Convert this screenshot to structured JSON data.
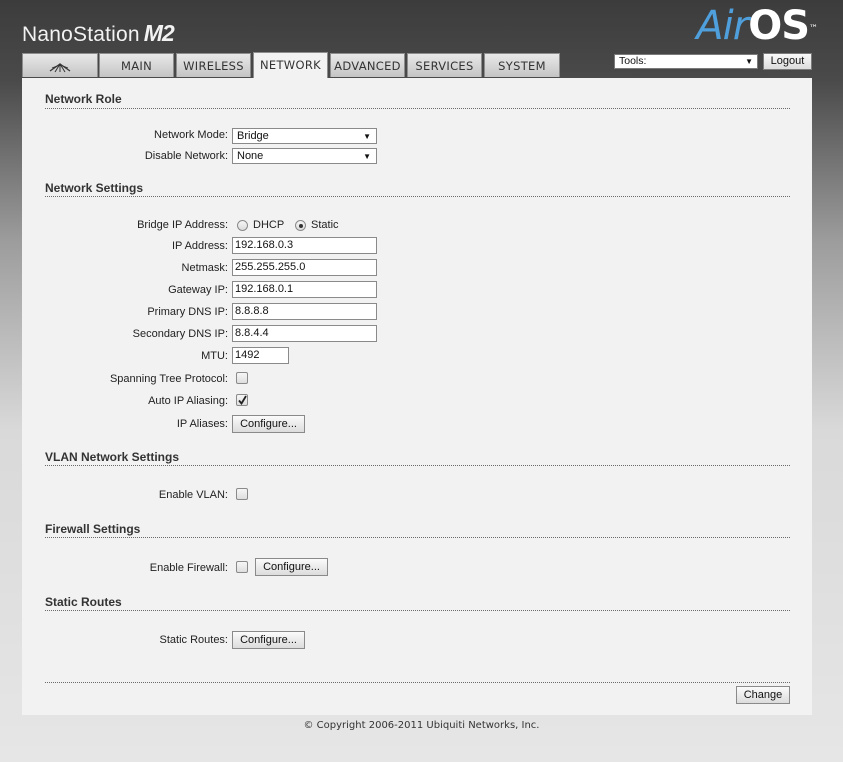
{
  "brand": {
    "name": "NanoStation",
    "model": "M2"
  },
  "logo": {
    "air": "Air",
    "os": "OS",
    "tm": "™"
  },
  "tabs": [
    {
      "icon": "ubiquiti-logo-icon"
    },
    {
      "label": "MAIN"
    },
    {
      "label": "WIRELESS"
    },
    {
      "label": "NETWORK",
      "active": true
    },
    {
      "label": "ADVANCED"
    },
    {
      "label": "SERVICES"
    },
    {
      "label": "SYSTEM"
    }
  ],
  "tools": {
    "value": "Tools:"
  },
  "logout_label": "Logout",
  "network_role": {
    "title": "Network Role",
    "mode_label": "Network Mode:",
    "mode_value": "Bridge",
    "disable_label": "Disable Network:",
    "disable_value": "None"
  },
  "network_settings": {
    "title": "Network Settings",
    "bridge_ip_label": "Bridge IP Address:",
    "dhcp_label": "DHCP",
    "static_label": "Static",
    "bridge_ip_selected": "Static",
    "ip_label": "IP Address:",
    "ip_value": "192.168.0.3",
    "netmask_label": "Netmask:",
    "netmask_value": "255.255.255.0",
    "gateway_label": "Gateway IP:",
    "gateway_value": "192.168.0.1",
    "primary_dns_label": "Primary DNS IP:",
    "primary_dns_value": "8.8.8.8",
    "secondary_dns_label": "Secondary DNS IP:",
    "secondary_dns_value": "8.8.4.4",
    "mtu_label": "MTU:",
    "mtu_value": "1492",
    "stp_label": "Spanning Tree Protocol:",
    "stp_checked": false,
    "auto_alias_label": "Auto IP Aliasing:",
    "auto_alias_checked": true,
    "ip_aliases_label": "IP Aliases:",
    "configure_label": "Configure..."
  },
  "vlan": {
    "title": "VLAN Network Settings",
    "enable_label": "Enable VLAN:",
    "enable_checked": false
  },
  "firewall": {
    "title": "Firewall Settings",
    "enable_label": "Enable Firewall:",
    "enable_checked": false,
    "configure_label": "Configure..."
  },
  "static_routes": {
    "title": "Static Routes",
    "label": "Static Routes:",
    "configure_label": "Configure..."
  },
  "change_label": "Change",
  "copyright": "© Copyright 2006-2011 Ubiquiti Networks, Inc."
}
